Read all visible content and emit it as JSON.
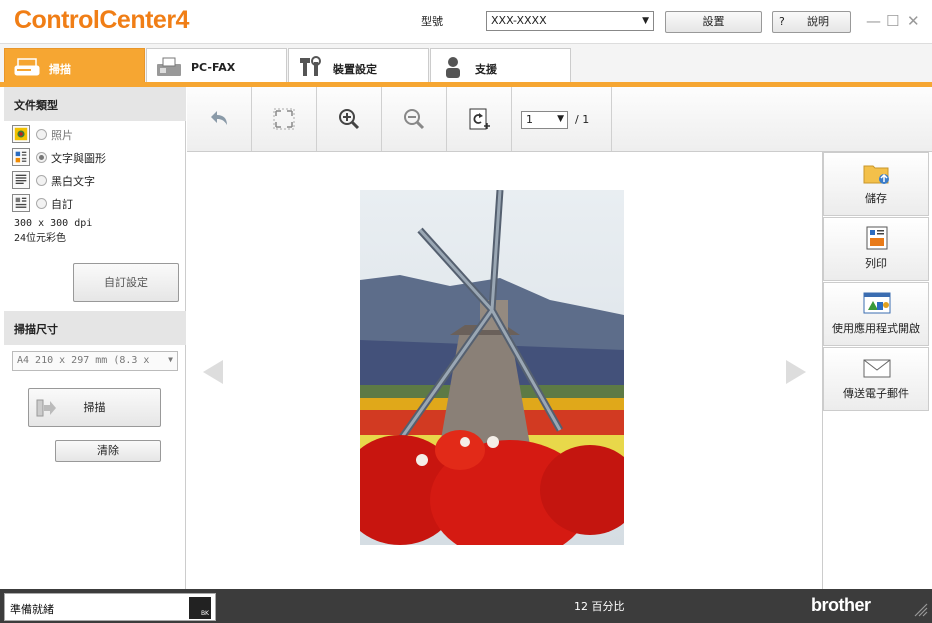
{
  "app": {
    "logo": "ControlCenter4"
  },
  "header": {
    "model_label": "型號",
    "model_value": "XXX-XXXX",
    "settings_label": "設置",
    "help_q": "?",
    "help_label": "說明"
  },
  "tabs": [
    {
      "label": "掃描",
      "active": true,
      "icon": "scanner-icon"
    },
    {
      "label": "PC-FAX",
      "active": false,
      "icon": "fax-icon"
    },
    {
      "label": "裝置設定",
      "active": false,
      "icon": "tools-icon"
    },
    {
      "label": "支援",
      "active": false,
      "icon": "person-icon"
    }
  ],
  "left": {
    "doc_type_heading": "文件類型",
    "doc_types": [
      {
        "label": "照片",
        "selected": false,
        "enabled": false,
        "icon": "photo-doc-icon"
      },
      {
        "label": "文字與圖形",
        "selected": true,
        "enabled": true,
        "icon": "text-graphics-doc-icon"
      },
      {
        "label": "黑白文字",
        "selected": false,
        "enabled": true,
        "icon": "bw-text-doc-icon"
      },
      {
        "label": "自訂",
        "selected": false,
        "enabled": true,
        "icon": "custom-doc-icon"
      }
    ],
    "resolution": "300 x 300 dpi",
    "color_mode": "24位元彩色",
    "custom_settings_label": "自訂設定",
    "scan_size_heading": "掃描尺寸",
    "scan_size_value": "A4 210 x 297 mm (8.3 x",
    "scan_label": "掃描",
    "clear_label": "清除"
  },
  "toolbar": {
    "buttons": [
      "undo-icon",
      "fit-page-icon",
      "zoom-in-icon",
      "zoom-out-icon",
      "rotate-icon"
    ],
    "page_current": "1",
    "page_total": "/ 1"
  },
  "actions": [
    {
      "label": "儲存",
      "icon": "folder-save-icon"
    },
    {
      "label": "列印",
      "icon": "print-icon"
    },
    {
      "label": "使用應用程式開啟",
      "icon": "open-app-icon"
    },
    {
      "label": "傳送電子郵件",
      "icon": "envelope-icon"
    }
  ],
  "status": {
    "ready_text": "準備就緒",
    "ink_label": "BK",
    "zoom_text": "12 百分比",
    "brand": "brother"
  }
}
